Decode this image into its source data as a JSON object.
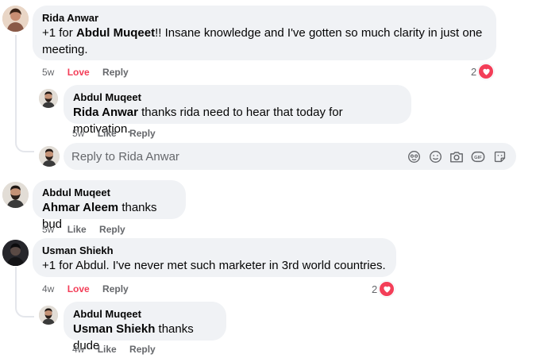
{
  "comments": [
    {
      "author": "Rida Anwar",
      "mention": "Abdul Muqeet",
      "text_before": "+1 for ",
      "text_line1_after": "!! Insane knowledge and I've gotten so much clarity in just one",
      "text_line2": "meeting.",
      "time": "5w",
      "love": "Love",
      "reply": "Reply",
      "reaction_count": "2",
      "reply_item": {
        "author": "Abdul Muqeet",
        "mention": "Rida Anwar",
        "text": " thanks rida need to hear that today for motivation.",
        "time": "5w",
        "like": "Like",
        "reply": "Reply"
      },
      "reply_input_placeholder": "Reply to Rida Anwar"
    },
    {
      "author": "Abdul Muqeet",
      "mention": "Ahmar Aleem",
      "text": " thanks bud",
      "time": "5w",
      "like": "Like",
      "reply": "Reply"
    },
    {
      "author": "Usman Shiekh",
      "text": "+1 for Abdul. I've never met such marketer in 3rd world countries.",
      "time": "4w",
      "love": "Love",
      "reply": "Reply",
      "reaction_count": "2",
      "reply_item": {
        "author": "Abdul Muqeet",
        "mention": "Usman Shiekh",
        "text": " thanks dude",
        "time": "4w",
        "like": "Like",
        "reply": "Reply"
      }
    }
  ],
  "icons": {
    "reaction": "heart-icon",
    "tools": [
      "avatar-sticker-icon",
      "emoji-icon",
      "camera-icon",
      "gif-icon",
      "sticker-icon"
    ]
  },
  "colors": {
    "love": "#f33e58",
    "bubble": "#f0f2f5",
    "muted": "#65676b"
  }
}
